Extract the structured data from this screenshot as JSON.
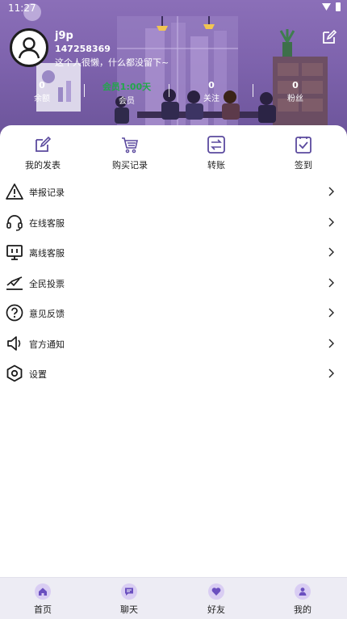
{
  "status_bar": {
    "time": "11:27"
  },
  "profile": {
    "username": "j9p",
    "user_id": "147258369",
    "bio": "这个人很懒，什么都没留下~"
  },
  "stats": [
    {
      "value": "0",
      "label": "余额"
    },
    {
      "value": "会员1:00天",
      "label": "会员"
    },
    {
      "value": "0",
      "label": "关注"
    },
    {
      "value": "0",
      "label": "粉丝"
    }
  ],
  "quick_actions": [
    {
      "label": "我的发表",
      "icon": "edit-icon"
    },
    {
      "label": "购买记录",
      "icon": "cart-icon"
    },
    {
      "label": "转账",
      "icon": "transfer-icon"
    },
    {
      "label": "签到",
      "icon": "checkin-icon"
    }
  ],
  "menu": [
    {
      "label": "举报记录",
      "icon": "warning-icon"
    },
    {
      "label": "在线客服",
      "icon": "headset-icon"
    },
    {
      "label": "离线客服",
      "icon": "monitor-icon"
    },
    {
      "label": "全民投票",
      "icon": "vote-icon"
    },
    {
      "label": "意见反馈",
      "icon": "question-icon"
    },
    {
      "label": "官方通知",
      "icon": "speaker-icon"
    },
    {
      "label": "设置",
      "icon": "settings-icon"
    }
  ],
  "tabs": [
    {
      "label": "首页",
      "icon": "home-icon"
    },
    {
      "label": "聊天",
      "icon": "chat-icon"
    },
    {
      "label": "好友",
      "icon": "heart-icon"
    },
    {
      "label": "我的",
      "icon": "user-icon"
    }
  ],
  "colors": {
    "accent": "#5b4a9e",
    "banner": "#7e63ad",
    "vip_green": "#22a84a",
    "tab_icon_bg": "#d9cdf3"
  }
}
